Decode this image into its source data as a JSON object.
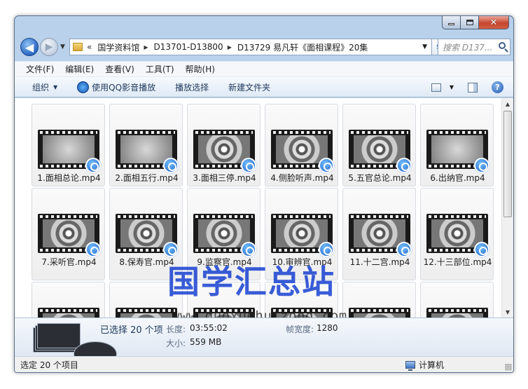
{
  "window": {
    "caption_buttons": {
      "minimize": "minimize-icon",
      "maximize": "maximize-icon",
      "close": "close-icon"
    }
  },
  "nav": {
    "breadcrumb_prefix": "«",
    "breadcrumbs": [
      "国学资料馆",
      "D13701-D13800",
      "D13729 易凡轩《面相课程》20集"
    ],
    "search_placeholder": "搜索 D137...",
    "back": "◀"
  },
  "menubar": [
    "文件(F)",
    "编辑(E)",
    "查看(V)",
    "工具(T)",
    "帮助(H)"
  ],
  "toolbar": {
    "organize": "组织",
    "play_qq": "使用QQ影音播放",
    "play_selection": "播放选择",
    "new_folder": "新建文件夹"
  },
  "files": [
    {
      "name": "1.面相总论.mp4",
      "thumb": "plain"
    },
    {
      "name": "2.面相五行.mp4",
      "thumb": "plain"
    },
    {
      "name": "3.面相三停.mp4",
      "thumb": "swirl"
    },
    {
      "name": "4.侧脸听声.mp4",
      "thumb": "swirl"
    },
    {
      "name": "5.五官总论.mp4",
      "thumb": "swirl"
    },
    {
      "name": "6.出纳官.mp4",
      "thumb": "plain"
    },
    {
      "name": "7.采听官.mp4",
      "thumb": "swirl"
    },
    {
      "name": "8.保寿官.mp4",
      "thumb": "swirl"
    },
    {
      "name": "9.监察官.mp4",
      "thumb": "swirl"
    },
    {
      "name": "10.审辨官.mp4",
      "thumb": "swirl"
    },
    {
      "name": "11.十二宫.mp4",
      "thumb": "swirl"
    },
    {
      "name": "12.十三部位.mp4",
      "thumb": "swirl"
    },
    {
      "name": "",
      "thumb": "swirl"
    },
    {
      "name": "",
      "thumb": "swirl"
    },
    {
      "name": "",
      "thumb": "swirl"
    },
    {
      "name": "",
      "thumb": "swirl"
    },
    {
      "name": "",
      "thumb": "swirl"
    },
    {
      "name": "",
      "thumb": "swirl"
    }
  ],
  "watermark": {
    "chinese": "国学汇总站",
    "url": "www.guoxuehuizong.com"
  },
  "details": {
    "selected": "已选择 20 个项",
    "length_label": "长度:",
    "length_value": "03:55:02",
    "size_label": "大小:",
    "size_value": "559 MB",
    "width_label": "帧宽度:",
    "width_value": "1280"
  },
  "statusbar": {
    "left": "选定 20 个项目",
    "right": "计算机"
  },
  "colors": {
    "window_frame": "#b9d1ea",
    "accent": "#1a5fc2",
    "watermark": "#1e46d2"
  }
}
